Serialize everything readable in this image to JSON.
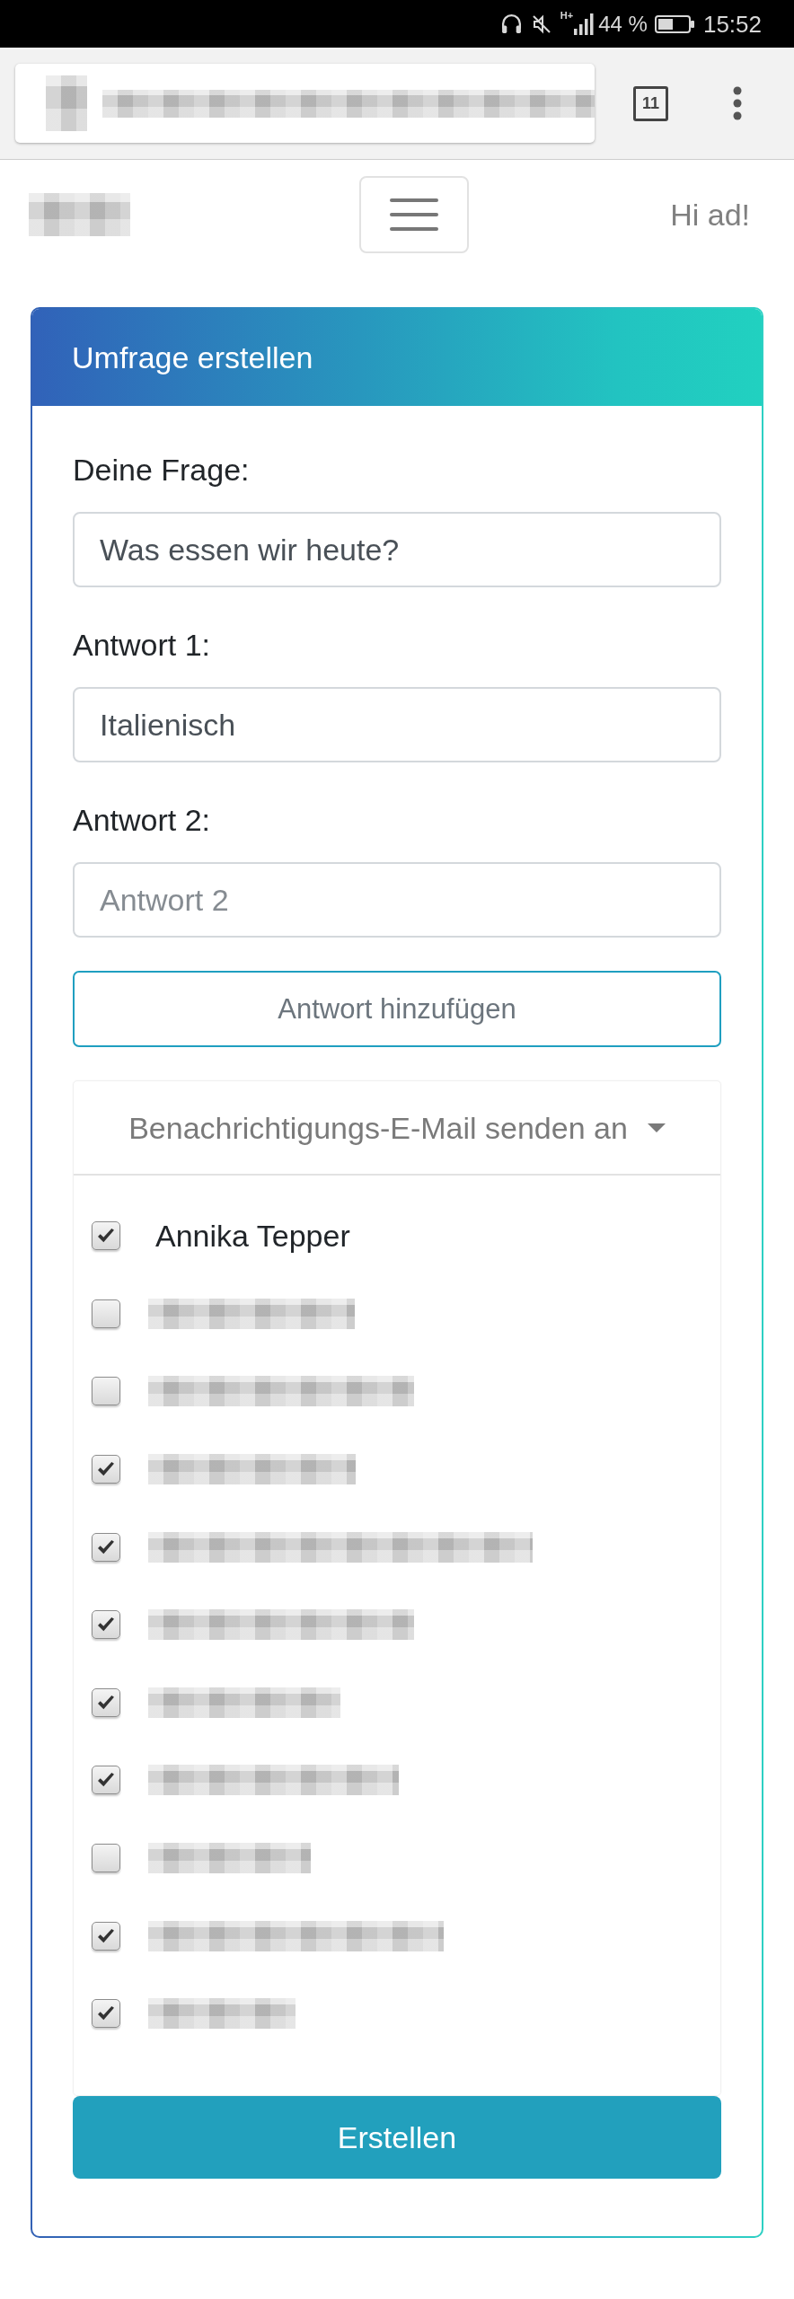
{
  "status_bar": {
    "network_type": "H+",
    "battery": "44 %",
    "time": "15:52"
  },
  "browser": {
    "tab_count": "11"
  },
  "navbar": {
    "greeting": "Hi ad!"
  },
  "card": {
    "title": "Umfrage erstellen",
    "fields": [
      {
        "label": "Deine Frage:",
        "value": "Was essen wir heute?"
      },
      {
        "label": "Antwort 1:",
        "value": "Italienisch"
      },
      {
        "label": "Antwort 2:",
        "placeholder": "Antwort 2"
      }
    ],
    "add_button": "Antwort hinzufügen",
    "notify": {
      "label": "Benachrichtigungs-E-Mail senden an",
      "expanded": true,
      "recipients": [
        {
          "kind": "name",
          "name": "Annika Tepper",
          "checked": true
        },
        {
          "kind": "redacted",
          "checked": false
        },
        {
          "kind": "redacted",
          "checked": false
        },
        {
          "kind": "redacted",
          "checked": true
        },
        {
          "kind": "redacted",
          "checked": true
        },
        {
          "kind": "redacted",
          "checked": true
        },
        {
          "kind": "redacted",
          "checked": true
        },
        {
          "kind": "redacted",
          "checked": true
        },
        {
          "kind": "redacted",
          "checked": false
        },
        {
          "kind": "redacted",
          "checked": true
        },
        {
          "kind": "redacted",
          "checked": true
        }
      ]
    },
    "submit_button": "Erstellen"
  }
}
